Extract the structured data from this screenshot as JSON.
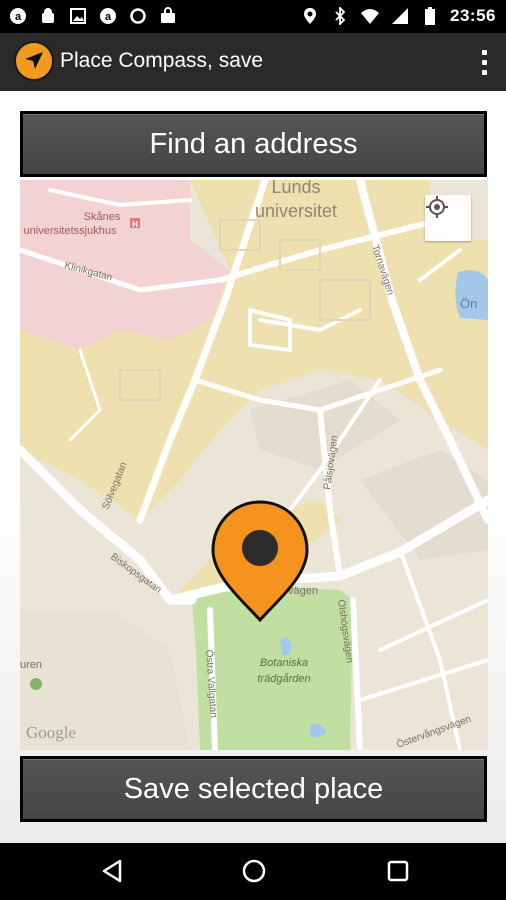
{
  "status_bar": {
    "time": "23:56",
    "left_icons": [
      "notification-a-icon",
      "android-debug-icon",
      "image-icon",
      "notification-b-icon",
      "sync-circle-icon",
      "shopping-bag-icon"
    ],
    "right_icons": [
      "location-pin-icon",
      "bluetooth-icon",
      "wifi-icon",
      "cell-signal-icon",
      "battery-icon"
    ]
  },
  "action_bar": {
    "title": "Place Compass, save",
    "logo_icon": "compass-arrow-icon",
    "menu_icon": "overflow-menu-icon"
  },
  "buttons": {
    "find_address": "Find an address",
    "save_place": "Save selected place"
  },
  "map": {
    "labels": {
      "lunds": "Lunds",
      "universitet": "universitet",
      "skanes": "Skånes",
      "sjukhus": "universitetssjukhus",
      "klinikgatan": "Klinikgatan",
      "tornavagen": "Tornavägen",
      "on": "Ön",
      "solvegatan": "Sölvegatan",
      "palsjovagen": "Pålsjövägen",
      "biskopsgatan": "Biskopsgatan",
      "vagen": "vägen",
      "olshogsvagen": "Olshögsvägen",
      "botaniska": "Botaniska",
      "tradgarden": "trädgården",
      "ostra_vallgatan": "Östra Vallgatan",
      "osterv": "Östervångsvägen",
      "uren": "uren",
      "google": "Google"
    },
    "colors": {
      "hospital": "#f3d2d3",
      "university": "#efe0b0",
      "park": "#c0dfa1",
      "marker": "#f6931e"
    }
  },
  "nav_bar": {
    "back_icon": "back-triangle-icon",
    "home_icon": "home-circle-icon",
    "recents_icon": "recents-square-icon"
  }
}
